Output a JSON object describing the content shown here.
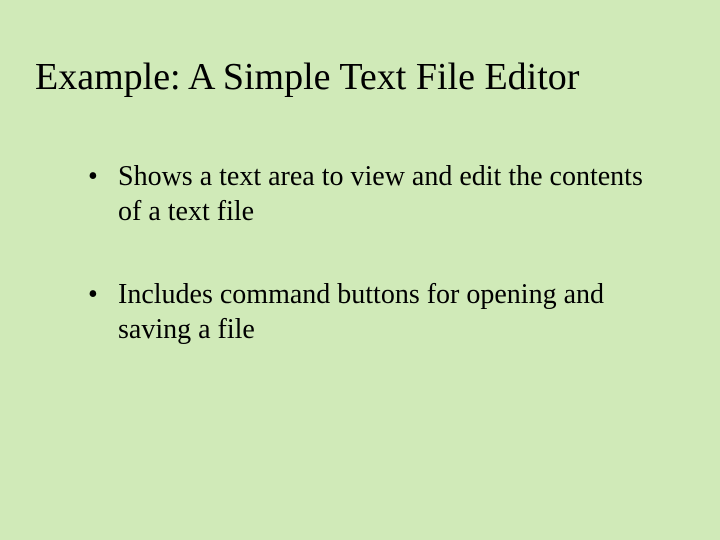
{
  "slide": {
    "title": "Example: A Simple Text File Editor",
    "bullets": [
      "Shows a text area to view and edit the contents of a text file",
      "Includes command buttons for opening and saving a file"
    ]
  }
}
